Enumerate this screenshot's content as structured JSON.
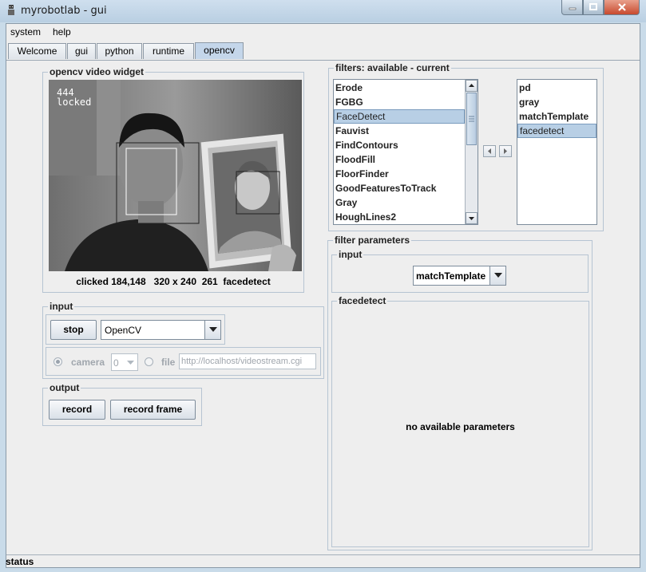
{
  "window": {
    "title": "myrobotlab - gui"
  },
  "menu": [
    "system",
    "help"
  ],
  "tabs": [
    "Welcome",
    "gui",
    "python",
    "runtime",
    "opencv"
  ],
  "video_widget": {
    "legend": "opencv  video widget",
    "overlay_count": "444",
    "overlay_status": "locked",
    "info": "clicked 184,148   320 x 240  261  facedetect"
  },
  "input": {
    "legend": "input",
    "stop_label": "stop",
    "grabber_value": "OpenCV",
    "camera_label": "camera",
    "camera_index": "0",
    "file_label": "file",
    "file_url": "http://localhost/videostream.cgi"
  },
  "output": {
    "legend": "output",
    "record_label": "record",
    "record_frame_label": "record frame"
  },
  "filters": {
    "legend": "filters: available - current",
    "available": [
      "Erode",
      "FGBG",
      "FaceDetect",
      "Fauvist",
      "FindContours",
      "FloodFill",
      "FloorFinder",
      "GoodFeaturesToTrack",
      "Gray",
      "HoughLines2"
    ],
    "available_selected": "FaceDetect",
    "current": [
      "pd",
      "gray",
      "matchTemplate",
      "facedetect"
    ],
    "current_selected": "facedetect"
  },
  "filter_parameters": {
    "legend": "filter parameters",
    "input_legend": "input",
    "input_value": "matchTemplate",
    "facedetect_legend": "facedetect",
    "message": "no available parameters"
  },
  "status": "status"
}
